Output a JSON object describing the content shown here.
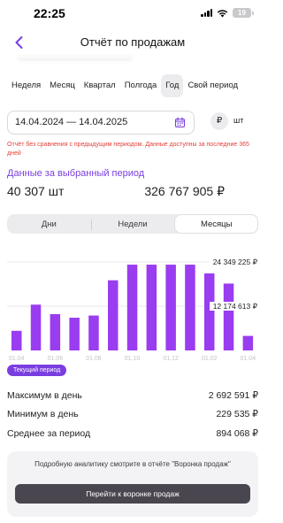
{
  "status_bar": {
    "time": "22:25",
    "battery": "19"
  },
  "header": {
    "title": "Отчёт по продажам"
  },
  "period_tabs": [
    {
      "label": "Неделя",
      "active": false
    },
    {
      "label": "Месяц",
      "active": false
    },
    {
      "label": "Квартал",
      "active": false
    },
    {
      "label": "Полгода",
      "active": false
    },
    {
      "label": "Год",
      "active": true
    },
    {
      "label": "Свой период",
      "active": false
    }
  ],
  "date_range": {
    "value": "14.04.2024 — 14.04.2025"
  },
  "currency": {
    "symbol": "₽",
    "unit": "шт"
  },
  "warning": "Отчёт без сравнения с предыдущим периодом. Данные доступны за последние 365 дней",
  "summary": {
    "title": "Данные за выбранный период",
    "quantity": "40 307 шт",
    "amount": "326 767 905 ₽"
  },
  "granularity": [
    {
      "label": "Дни",
      "active": false
    },
    {
      "label": "Недели",
      "active": false
    },
    {
      "label": "Месяцы",
      "active": true
    }
  ],
  "chart_data": {
    "type": "bar",
    "categories": [
      "01.04",
      "01.05",
      "01.06",
      "01.07",
      "01.08",
      "01.09",
      "01.10",
      "01.11",
      "01.12",
      "01.01",
      "01.02",
      "01.03",
      "01.04"
    ],
    "tick_labels": [
      "01.04",
      "01.06",
      "01.08",
      "01.10",
      "01.12",
      "01.02",
      "01.04"
    ],
    "values": [
      5400000,
      12600000,
      10000000,
      9000000,
      9600000,
      19300000,
      23600000,
      23600000,
      23600000,
      23600000,
      21200000,
      18400000,
      4000000
    ],
    "y_labels": [
      "24 349 225 ₽",
      "12 174 613 ₽"
    ],
    "y_label_values": [
      24349225,
      12174613
    ],
    "ylim": [
      0,
      24349225
    ],
    "colors": {
      "bar": "#9a3cf0",
      "grid": "#e3e3e8"
    }
  },
  "current_period_label": "Текущий период",
  "stats": [
    {
      "label": "Максимум в день",
      "value": "2 692 591 ₽"
    },
    {
      "label": "Минимум в день",
      "value": "229 535 ₽"
    },
    {
      "label": "Среднее за период",
      "value": "894 068 ₽"
    }
  ],
  "promo": {
    "text": "Подробную аналитику смотрите в отчёте \"Воронка продаж\"",
    "button": "Перейти к воронке продаж"
  }
}
